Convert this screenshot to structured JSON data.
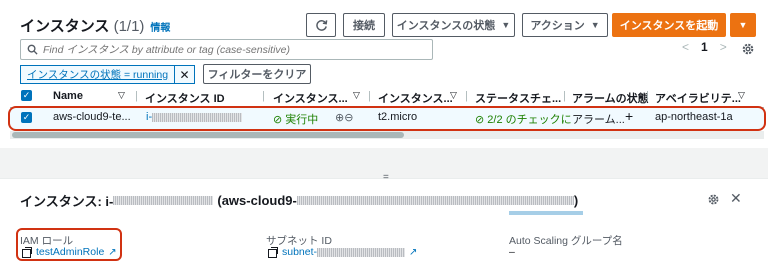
{
  "header": {
    "title": "インスタンス",
    "count": "(1/1)",
    "info_link": "情報"
  },
  "toolbar": {
    "refresh_icon": "refresh-icon",
    "connect_label": "接続",
    "state_label": "インスタンスの状態",
    "actions_label": "アクション",
    "launch_label": "インスタンスを起動",
    "launch_color": "#ec7211"
  },
  "search": {
    "placeholder": "Find インスタンス by attribute or tag (case-sensitive)"
  },
  "pagination": {
    "prev": "<",
    "page": "1",
    "next": ">"
  },
  "filter": {
    "chip_label": "インスタンスの状態 = running",
    "chip_remove": "✕",
    "clear_label": "フィルターをクリア"
  },
  "table": {
    "headers": [
      "Name",
      "インスタンス ID",
      "インスタンス...",
      "インスタンス...",
      "ステータスチェ...",
      "アラームの状態",
      "アベイラビリテ..."
    ],
    "row": {
      "name": "aws-cloud9-te...",
      "id_prefix": "i-",
      "state": "実行中",
      "type": "t2.micro",
      "status_check": "2/2 のチェックに",
      "alarm": "アラーム...",
      "alarm_add": "+",
      "az": "ap-northeast-1a"
    }
  },
  "details": {
    "handle": "=",
    "title_prefix": "インスタンス: i-",
    "title_mid": "(aws-cloud9-",
    "title_suffix": ")",
    "iam_label": "IAM ロール",
    "iam_value": "testAdminRole",
    "subnet_label": "サブネット ID",
    "subnet_prefix": "subnet-",
    "asg_label": "Auto Scaling グループ名",
    "asg_value": "–"
  },
  "colors": {
    "accent": "#0073bb",
    "highlight_border": "#d13212",
    "success": "#1d8102"
  }
}
